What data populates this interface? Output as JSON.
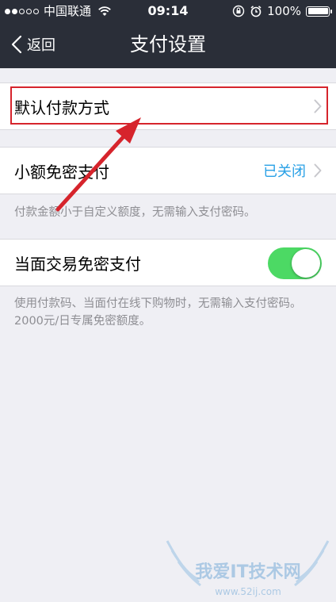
{
  "status_bar": {
    "carrier": "中国联通",
    "time": "09:14",
    "battery": "100%"
  },
  "nav": {
    "back_label": "返回",
    "title": "支付设置"
  },
  "settings": {
    "default_payment": {
      "label": "默认付款方式"
    },
    "small_amount": {
      "label": "小额免密支付",
      "value": "已关闭",
      "hint": "付款金额小于自定义额度，无需输入支付密码。"
    },
    "face_to_face": {
      "label": "当面交易免密支付",
      "enabled": true,
      "hint": "使用付款码、当面付在线下购物时，无需输入支付密码。2000元/日专属免密额度。"
    }
  },
  "colors": {
    "header_bg": "#2a2e38",
    "page_bg": "#efeff4",
    "accent_blue": "#28a0e6",
    "toggle_green": "#4cd964",
    "annotation_red": "#d6242c"
  },
  "icons": [
    "signal-icon",
    "wifi-icon",
    "lock-rotation-icon",
    "alarm-icon",
    "battery-icon",
    "back-chevron-icon",
    "chevron-right-icon"
  ],
  "watermark": {
    "text": "我爱IT技术网",
    "url": "www.52ij.com"
  }
}
